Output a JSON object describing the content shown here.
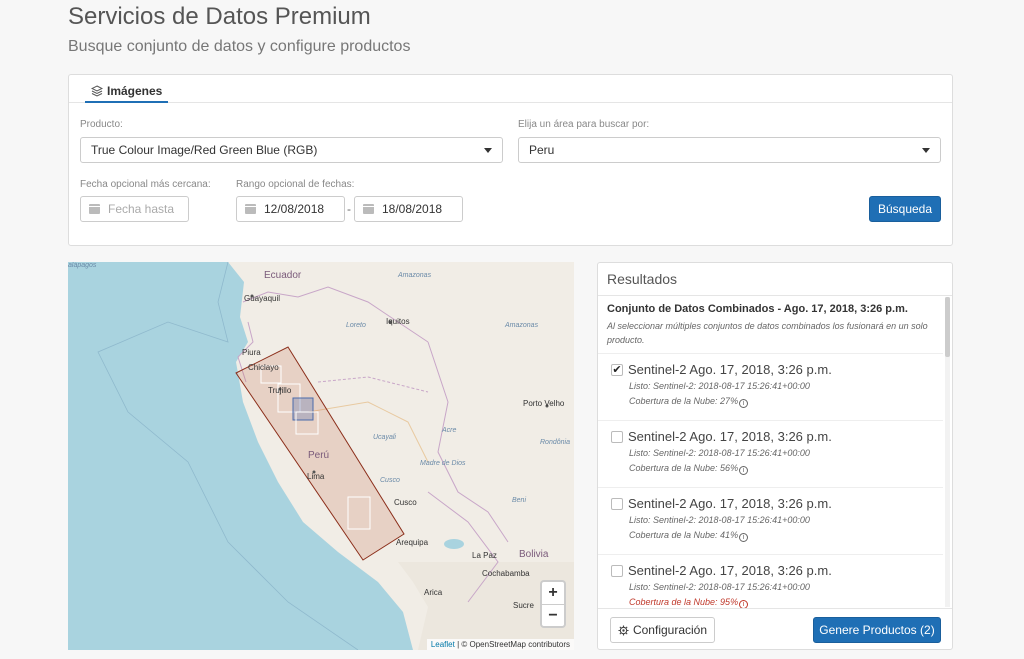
{
  "header": {
    "title": "Servicios de Datos Premium",
    "subtitle": "Busque conjunto de datos y configure productos"
  },
  "search": {
    "tab_label": "Imágenes",
    "product_label": "Producto:",
    "product_value": "True Colour Image/Red Green Blue (RGB)",
    "area_label": "Elija un área para buscar por:",
    "area_value": "Peru",
    "nearest_date_label": "Fecha opcional más cercana:",
    "nearest_date_placeholder": "Fecha hasta",
    "range_label": "Rango opcional de fechas:",
    "range_start": "12/08/2018",
    "range_separator": "-",
    "range_end": "18/08/2018",
    "search_button": "Búsqueda"
  },
  "map": {
    "labels": {
      "galapagos": "alápagos",
      "ecuador": "Ecuador",
      "guayaquil": "Guayaquil",
      "amazonas1": "Amazonas",
      "loreto": "Loreto",
      "iquitos": "Iquitos",
      "amazonas2": "Amazonas",
      "piura": "Piura",
      "chiclayo": "Chiclayo",
      "trujillo": "Trujillo",
      "porto_velho": "Porto Velho",
      "acre": "Acre",
      "ucayali": "Ucayali",
      "rondonia": "Rondônia",
      "peru": "Perú",
      "lima": "Lima",
      "madre_de_dios": "Madre de Dios",
      "cusco_region": "Cusco",
      "cusco": "Cusco",
      "beni": "Beni",
      "arequipa": "Arequipa",
      "la_paz": "La Paz",
      "bolivia": "Bolivia",
      "cochabamba": "Cochabamba",
      "arica": "Arica",
      "sucre": "Sucre"
    },
    "zoom_in": "+",
    "zoom_out": "−",
    "attribution_link": "Leaflet",
    "attribution_text": " | © OpenStreetMap contributors"
  },
  "results": {
    "title": "Resultados",
    "combined_title": "Conjunto de Datos Combinados - Ago. 17, 2018, 3:26 p.m.",
    "combined_note": "Al seleccionar múltiples conjuntos de datos combinados los fusionará en un solo producto.",
    "items": [
      {
        "name": "Sentinel-2 Ago. 17, 2018, 3:26 p.m.",
        "ready": "Listo: Sentinel-2: 2018-08-17 15:26:41+00:00",
        "cloud": "Cobertura de la Nube: 27%",
        "checked": true,
        "check_mark": "✔"
      },
      {
        "name": "Sentinel-2 Ago. 17, 2018, 3:26 p.m.",
        "ready": "Listo: Sentinel-2: 2018-08-17 15:26:41+00:00",
        "cloud": "Cobertura de la Nube: 56%",
        "checked": false
      },
      {
        "name": "Sentinel-2 Ago. 17, 2018, 3:26 p.m.",
        "ready": "Listo: Sentinel-2: 2018-08-17 15:26:41+00:00",
        "cloud": "Cobertura de la Nube: 41%",
        "checked": false
      },
      {
        "name": "Sentinel-2 Ago. 17, 2018, 3:26 p.m.",
        "ready": "Listo: Sentinel-2: 2018-08-17 15:26:41+00:00",
        "cloud": "Cobertura de la Nube: 95%",
        "checked": false
      }
    ],
    "info_glyph": "i",
    "config_button": "Configuración",
    "generate_button": "Genere Productos (2)"
  },
  "colors": {
    "primary": "#1f6fb5",
    "warning": "#c0392b",
    "aoi_stroke": "#8b2e1a"
  }
}
